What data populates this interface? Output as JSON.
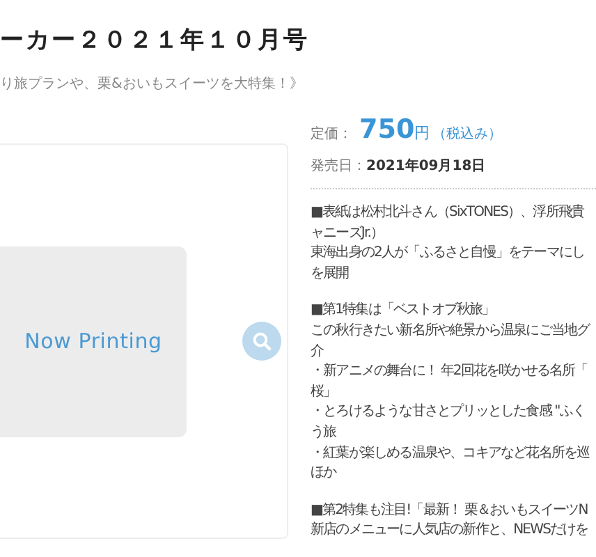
{
  "title": "ーカー２０２１年１０月号",
  "subtitle": "り旅プランや、栗&おいもスイーツを大特集！》",
  "cover": {
    "placeholder": "Now Printing"
  },
  "price": {
    "label": "定価：",
    "amount": "750",
    "unit": "円",
    "tax_note": "（税込み）"
  },
  "release": {
    "label": "発売日：",
    "date": "2021年09月18日"
  },
  "description": [
    {
      "lines": [
        "■表紙は松村北斗さん（SixTONES）、浮所飛貴",
        "ャニーズJr.）",
        "東海出身の2人が「ふるさと自慢」をテーマにし",
        "を展開"
      ]
    },
    {
      "lines": [
        "■第1特集は「ベストオブ秋旅」",
        "この秋行きたい新名所や絶景から温泉にご当地グ",
        "介",
        "・新アニメの舞台に！ 年2回花を咲かせる名所「",
        "桜」",
        "・とろけるような甘さとプリッとした食感 \"ふく",
        "う旅",
        "・紅葉が楽しめる温泉や、コキアなど花名所を巡",
        "ほか"
      ]
    },
    {
      "lines": [
        "■第2特集も注目!「最新！ 栗＆おいもスイーツN",
        "新店のメニューに人気店の新作と、NEWSだけを"
      ]
    }
  ]
}
